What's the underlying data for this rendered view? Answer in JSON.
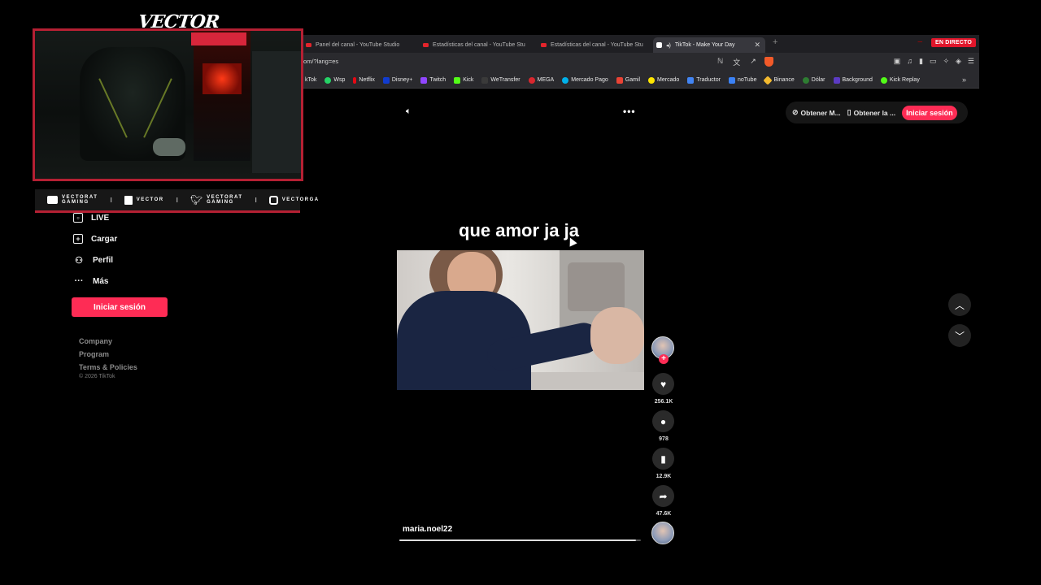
{
  "overlay": {
    "brand_logo": "VECTOR",
    "cam_marquee": "",
    "socials": [
      {
        "line1": "VECTORAT",
        "line2": "GAMING"
      },
      {
        "line1": "VECTOR",
        "line2": ""
      },
      {
        "line1": "VECTORAT",
        "line2": "GAMING"
      },
      {
        "line1": "VECTORGA",
        "line2": ""
      }
    ],
    "separator": "I"
  },
  "browser": {
    "tabs": [
      {
        "label": "Panel del canal - YouTube Studio"
      },
      {
        "label": "Estadísticas del canal - YouTube Stu"
      },
      {
        "label": "Estadísticas del canal - YouTube Stu"
      },
      {
        "label": "TikTok - Make Your Day",
        "active": true
      }
    ],
    "live_badge": "EN DIRECTO",
    "url": "om/?lang=es",
    "bookmarks": [
      {
        "label": "kTok",
        "color": "#ffffff"
      },
      {
        "label": "Wsp",
        "color": "#25d366"
      },
      {
        "label": "Netflix",
        "color": "#e50914"
      },
      {
        "label": "Disney+",
        "color": "#113ccf"
      },
      {
        "label": "Twitch",
        "color": "#9146ff"
      },
      {
        "label": "Kick",
        "color": "#53fc18"
      },
      {
        "label": "WeTransfer",
        "color": "#3a3a3a"
      },
      {
        "label": "MEGA",
        "color": "#d9272e"
      },
      {
        "label": "Mercado Pago",
        "color": "#00b1ea"
      },
      {
        "label": "Gamil",
        "color": "#ea4335"
      },
      {
        "label": "Mercado",
        "color": "#ffe600"
      },
      {
        "label": "Traductor",
        "color": "#4285f4"
      },
      {
        "label": "noTube",
        "color": "#3b82f6"
      },
      {
        "label": "Binance",
        "color": "#f3ba2f"
      },
      {
        "label": "Dólar",
        "color": "#2e7d32"
      },
      {
        "label": "Background",
        "color": "#5c3bc4"
      },
      {
        "label": "Kick Replay",
        "color": "#53fc18"
      }
    ]
  },
  "sidebar": {
    "items": [
      {
        "label": "LIVE",
        "icon": "live-icon"
      },
      {
        "label": "Cargar",
        "icon": "upload-icon"
      },
      {
        "label": "Perfil",
        "icon": "profile-icon"
      },
      {
        "label": "Más",
        "icon": "more-icon"
      }
    ],
    "login_label": "Iniciar sesión",
    "footer": [
      "Company",
      "Program",
      "Terms & Policies"
    ],
    "copyright": "© 2026 TikTok"
  },
  "top_actions": {
    "get_app1": "Obtener M...",
    "get_app2": "Obtener la ...",
    "login": "Iniciar sesión"
  },
  "video": {
    "caption": "que amor ja ja",
    "author": "maria.noel22",
    "progress": 0.98,
    "likes": "256.1K",
    "comments": "978",
    "saves": "12.9K",
    "shares": "47.6K"
  },
  "colors": {
    "accent": "#fe2c55",
    "overlay_border": "#b52033"
  }
}
